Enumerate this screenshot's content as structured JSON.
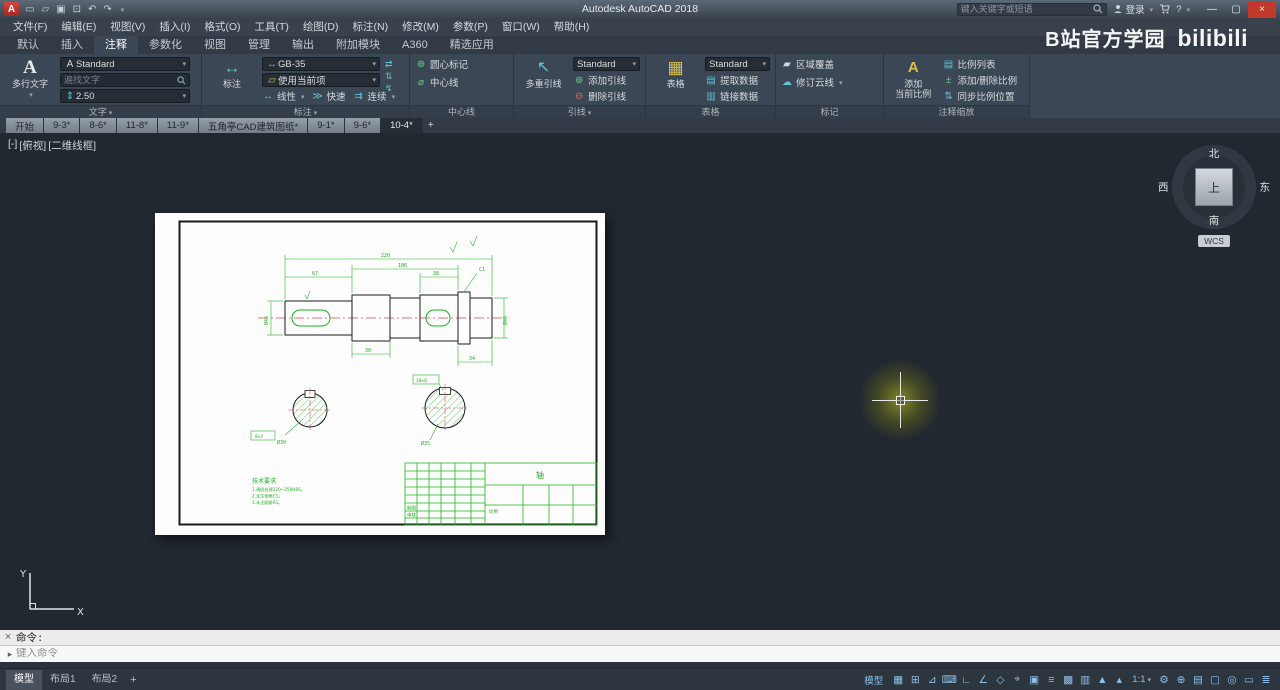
{
  "titlebar": {
    "title": "Autodesk AutoCAD 2018",
    "search_placeholder": "键入关键字或短语",
    "signin_label": "登录",
    "window": {
      "minimize": "—",
      "maximize": "▢",
      "close": "×"
    }
  },
  "watermark": {
    "text": "B站官方学园",
    "logo": "bilibili"
  },
  "menubar": {
    "items": [
      "文件(F)",
      "编辑(E)",
      "视图(V)",
      "插入(I)",
      "格式(O)",
      "工具(T)",
      "绘图(D)",
      "标注(N)",
      "修改(M)",
      "参数(P)",
      "窗口(W)",
      "帮助(H)"
    ]
  },
  "ribbon": {
    "tabs": [
      "默认",
      "插入",
      "注释",
      "参数化",
      "视图",
      "管理",
      "输出",
      "附加模块",
      "A360",
      "精选应用"
    ],
    "text_panel": {
      "big": "多行文字",
      "style": "Standard",
      "find_placeholder": "遍找文字",
      "height": "2.50",
      "footer": "文字"
    },
    "dim_panel": {
      "big": "标注",
      "style": "GB-35",
      "layer": "使用当前项",
      "linear": "线性",
      "quick": "快速",
      "cont": "连续",
      "footer": "标注"
    },
    "center_panel": {
      "mark": "圆心标记",
      "line": "中心线",
      "footer": "中心线"
    },
    "leader_panel": {
      "big": "多重引线",
      "style": "Standard",
      "add": "添加引线",
      "remove": "删除引线",
      "footer": "引线"
    },
    "table_panel": {
      "big": "表格",
      "style": "Standard",
      "extract": "提取数据",
      "link": "链接数据",
      "footer": "表格"
    },
    "markup_panel": {
      "wipeout": "区域覆盖",
      "revcloud": "修订云线",
      "footer": "标记"
    },
    "scale_panel": {
      "big_line1": "添加",
      "big_line2": "当前比例",
      "list": "比例列表",
      "addremove": "添加/删除比例",
      "sync": "同步比例位置",
      "footer": "注释缩放"
    }
  },
  "glyphs": {
    "new": "▭",
    "open": "▱",
    "save": "▣",
    "plot": "⊡",
    "undo": "↶",
    "redo": "↷",
    "mtext": "A",
    "style_a": "A",
    "text_height": "⇕",
    "dim": "↔",
    "layers": "▱",
    "linear": "↔",
    "quick": "≫",
    "cont": "⇉",
    "center_mark": "⊕",
    "center_line": "⌀",
    "mleader": "↖",
    "add_leader": "⊕",
    "del_leader": "⊖",
    "table": "▦",
    "extract": "▤",
    "link": "▥",
    "wipeout": "▰",
    "revcloud": "☁",
    "scale_big": "A",
    "scale_list": "▤",
    "scale_addremove": "±",
    "scale_sync": "⇅",
    "dim_break": "⇄",
    "dim_space": "⇅",
    "dim_jog": "↯",
    "help": "?"
  },
  "filetabs": {
    "tabs": [
      "开始",
      "9-3*",
      "8-6*",
      "11-8*",
      "11-9*",
      "五角亭CAD建筑图纸*",
      "9-1*",
      "9-6*",
      "10-4*"
    ],
    "new_tab": "+"
  },
  "viewport": {
    "controls": [
      "[-]",
      "[俯视]",
      "[二维线框]"
    ]
  },
  "viewcube": {
    "north": "北",
    "south": "南",
    "west": "西",
    "east": "东",
    "top": "上",
    "wcs": "WCS"
  },
  "ucs": {
    "x": "X",
    "y": "Y"
  },
  "drawing": {
    "tech": {
      "title": "技术要求",
      "line1": "1.调质处理220~250HBS。",
      "line2": "2.未注倒角C1。",
      "line3": "3.未注圆角R1。"
    },
    "dims": {
      "total": "220",
      "mid": "106",
      "left": "67",
      "seg": "38",
      "key1": "30",
      "key2": "34",
      "dia_left": "Ø45",
      "dia_right": "Ø40",
      "chamfer": "C1",
      "circa_dia": "Ø30",
      "circa_key": "8×7",
      "circb_dia": "Ø35",
      "circb_key": "10×8"
    },
    "titleblock": {
      "draft": "制图",
      "check": "审核",
      "scale": "比例",
      "name": "轴"
    }
  },
  "command": {
    "prompt": "命令:",
    "input_placeholder": "键入命令",
    "close": "×"
  },
  "statusbar": {
    "tabs": [
      "模型",
      "布局1",
      "布局2"
    ],
    "new_layout": "+",
    "model_badge": "模型",
    "scale": "1:1",
    "icons_a": [
      {
        "name": "grid-icon",
        "glyph": "▦"
      },
      {
        "name": "snap-mode-icon",
        "glyph": "⊞"
      },
      {
        "name": "infer-constraints-icon",
        "glyph": "⊿"
      },
      {
        "name": "dynamic-input-icon",
        "glyph": "⌨"
      },
      {
        "name": "ortho-mode-icon",
        "glyph": "∟"
      },
      {
        "name": "polar-tracking-icon",
        "glyph": "∠"
      },
      {
        "name": "isodraft-icon",
        "glyph": "◇"
      },
      {
        "name": "osnap-tracking-icon",
        "glyph": "⌖"
      },
      {
        "name": "osnap-icon",
        "glyph": "▣"
      },
      {
        "name": "lineweight-icon",
        "glyph": "≡"
      },
      {
        "name": "transparency-icon",
        "glyph": "▩"
      },
      {
        "name": "selection-cycling-icon",
        "glyph": "▥"
      },
      {
        "name": "annotation-visibility-icon",
        "glyph": "▲"
      },
      {
        "name": "autoscale-icon",
        "glyph": "▴"
      }
    ],
    "icons_b": [
      {
        "name": "workspace-gear-icon",
        "glyph": "⚙"
      },
      {
        "name": "annotation-monitor-icon",
        "glyph": "⊕"
      },
      {
        "name": "quick-properties-icon",
        "glyph": "▤"
      },
      {
        "name": "lock-ui-icon",
        "glyph": "▢"
      },
      {
        "name": "isolate-objects-icon",
        "glyph": "◎"
      },
      {
        "name": "clean-screen-icon",
        "glyph": "▭"
      },
      {
        "name": "customize-icon",
        "glyph": "≣"
      }
    ]
  }
}
